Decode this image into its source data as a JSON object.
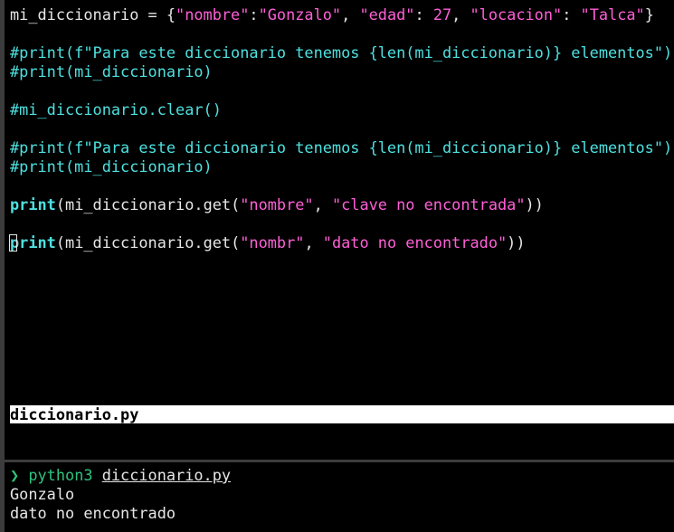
{
  "colors": {
    "background": "#000000",
    "text": "#e6e6e6",
    "comment": "#4ee0e0",
    "keyword": "#4ee0e0",
    "string": "#ff5fd7",
    "number": "#ff5fd7",
    "prompt": "#2ec27e",
    "status_bar_bg": "#ffffff",
    "pane_border": "#3c3c3c"
  },
  "editor": {
    "line1": {
      "a": "mi_diccionario = {",
      "b": "\"nombre\"",
      "c": ":",
      "d": "\"Gonzalo\"",
      "e": ", ",
      "f": "\"edad\"",
      "g": ": ",
      "h": "27",
      "i": ", ",
      "j": "\"locacion\"",
      "k": ": ",
      "l": "\"Talca\"",
      "m": "}"
    },
    "line3": "#print(f\"Para este diccionario tenemos {len(mi_diccionario)} elementos\")",
    "line4": "#print(mi_diccionario)",
    "line6": "#mi_diccionario.clear()",
    "line8": "#print(f\"Para este diccionario tenemos {len(mi_diccionario)} elementos\")",
    "line9": "#print(mi_diccionario)",
    "line11": {
      "kw": "print",
      "a": "(mi_diccionario.get(",
      "b": "\"nombre\"",
      "c": ", ",
      "d": "\"clave no encontrada\"",
      "e": "))"
    },
    "line13": {
      "kw_first": "p",
      "kw_rest": "rint",
      "a": "(mi_diccionario.get(",
      "b": "\"nombr\"",
      "c": ", ",
      "d": "\"dato no encontrado\"",
      "e": "))"
    }
  },
  "status_bar": {
    "filename": "diccionario.py"
  },
  "terminal": {
    "prompt_symbol": "❯",
    "command": "python3",
    "argument": "diccionario.py",
    "output": [
      "Gonzalo",
      "dato no encontrado"
    ]
  }
}
